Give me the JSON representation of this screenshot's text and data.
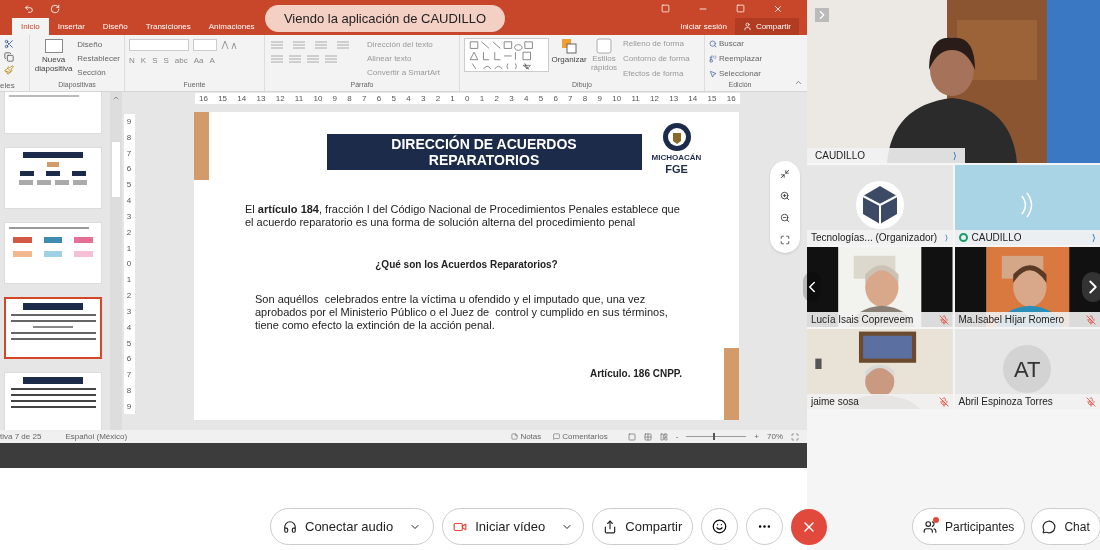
{
  "banner": "Viendo la aplicación de CAUDILLO",
  "ppt": {
    "tabs": [
      {
        "label": "Inicio",
        "selected": true
      },
      {
        "label": "Insertar",
        "selected": false
      },
      {
        "label": "Diseño",
        "selected": false
      },
      {
        "label": "Transiciones",
        "selected": false
      },
      {
        "label": "Animaciones",
        "selected": false
      }
    ],
    "signin": "Iniciar sesión",
    "share": "Compartir",
    "groups": {
      "clipboard": "eles",
      "slides": {
        "label": "Diapositivas",
        "new": "Nueva diapositiva",
        "items": [
          "Diseño",
          "Restablecer",
          "Sección"
        ]
      },
      "font": {
        "label": "Fuente",
        "format": [
          "N",
          "K",
          "S",
          "S",
          "abc",
          "Aa",
          "A"
        ]
      },
      "paragraph": {
        "label": "Párrafo",
        "items": [
          "Dirección del texto",
          "Alinear texto",
          "Convertir a SmartArt"
        ]
      },
      "drawing": {
        "label": "Dibujo",
        "arrange": "Organizar",
        "styles": "Estilos rápidos",
        "items": [
          "Relleno de forma",
          "Contorno de forma",
          "Efectos de forma"
        ]
      },
      "editing": {
        "label": "Edición",
        "items": [
          "Buscar",
          "Reemplazar",
          "Seleccionar"
        ]
      }
    },
    "ruler_h": [
      "16",
      "15",
      "14",
      "13",
      "12",
      "11",
      "10",
      "9",
      "8",
      "7",
      "6",
      "5",
      "4",
      "3",
      "2",
      "1",
      "0",
      "1",
      "2",
      "3",
      "4",
      "5",
      "6",
      "7",
      "8",
      "9",
      "10",
      "11",
      "12",
      "13",
      "14",
      "15",
      "16"
    ],
    "ruler_v": [
      "9",
      "8",
      "7",
      "6",
      "5",
      "4",
      "3",
      "2",
      "1",
      "0",
      "1",
      "2",
      "3",
      "4",
      "5",
      "6",
      "7",
      "8",
      "9"
    ],
    "thumbnails": [
      {
        "selected": false
      },
      {
        "selected": false
      },
      {
        "selected": false
      },
      {
        "selected": true
      },
      {
        "selected": false
      }
    ],
    "slide": {
      "title": "DIRECCIÓN DE ACUERDOS REPARATORIOS",
      "logo": [
        "MICHOACÁN",
        "FGE"
      ],
      "intro": "El **artículo 184**, fracción I del Código Nacional de Procedimientos Penales establece que el acuerdo reparatorio es una forma de solución alterna del procedimiento penal",
      "question": "¿Qué son los Acuerdos Reparatorios?",
      "answer": "Son aquéllos  celebrados entre la víctima u ofendido y el imputado que, una vez aprobados por el Ministerio Público o el Juez de  control y cumplido en sus términos, tiene como efecto la extinción de la acción penal.",
      "reference": "Artículo. 186 CNPP."
    },
    "status": {
      "slide": "tiva 7 de 25",
      "language": "Español (México)",
      "notes": "Notas",
      "comments": "Comentarios",
      "minus": "-",
      "plus": "+",
      "zoom": "70%",
      "level": 0.45
    }
  },
  "main_video": {
    "name": "CAUDILLO"
  },
  "tiles": [
    {
      "kind": "logo",
      "name": "Tecnologías...  (Organizador)",
      "muted": false
    },
    {
      "kind": "audio",
      "name": "CAUDILLO",
      "muted": false
    },
    {
      "kind": "video",
      "name": "Lucía Isais Copreveem",
      "muted": true
    },
    {
      "kind": "video",
      "name": "Ma.Isabel Híjar Romero",
      "muted": true
    },
    {
      "kind": "video",
      "name": "jaime sosa",
      "muted": true
    },
    {
      "kind": "initials",
      "initials": "AT",
      "name": "Abril Espinoza Torres",
      "muted": true
    }
  ],
  "controls": {
    "audio": "Conectar audio",
    "video": "Iniciar vídeo",
    "share": "Compartir",
    "participants": "Participantes",
    "participants_alert": true,
    "chat": "Chat"
  }
}
